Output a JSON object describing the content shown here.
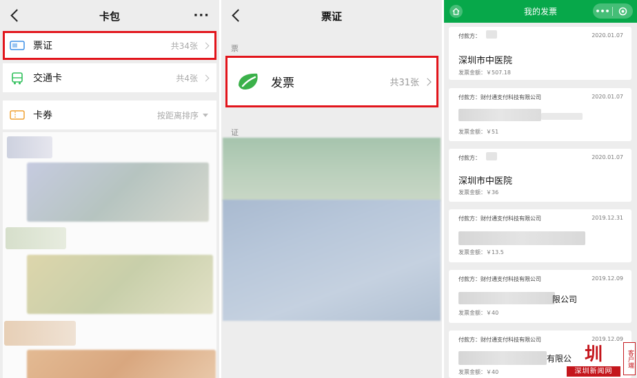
{
  "left": {
    "title": "卡包",
    "more": "···",
    "rows": [
      {
        "label": "票证",
        "count": "共34张"
      },
      {
        "label": "交通卡",
        "count": "共4张"
      },
      {
        "label": "卡券",
        "count": "按距离排序"
      }
    ]
  },
  "middle": {
    "title": "票证",
    "section_ticket": "票",
    "invoice_label": "发票",
    "invoice_count": "共31张",
    "section_cert": "证"
  },
  "right": {
    "title": "我的发票",
    "capsule_dots": "•••",
    "cards": [
      {
        "payer": "付款方：",
        "date": "2020.01.07",
        "big": "深圳市中医院",
        "amount": "发票金额：￥507.18"
      },
      {
        "payer": "付款方：财付通支付科技有限公司",
        "date": "2020.01.07",
        "big": "",
        "amount": "发票金额：￥51"
      },
      {
        "payer": "付款方：",
        "date": "2020.01.07",
        "big": "深圳市中医院",
        "amount": "发票金额：￥36"
      },
      {
        "payer": "付款方：财付通支付科技有限公司",
        "date": "2019.12.31",
        "big": "",
        "amount": "发票金额：￥13.5"
      },
      {
        "payer": "付款方：财付通支付科技有限公司",
        "date": "2019.12.09",
        "big": "限公司",
        "amount": "发票金额：￥40"
      },
      {
        "payer": "付款方：财付通支付科技有限公司",
        "date": "2019.12.09",
        "big": "有限公",
        "amount": "发票金额：￥40"
      }
    ]
  },
  "watermark": {
    "mark": "圳",
    "sub": "深圳新闻网",
    "vertical": "客户端"
  },
  "colors": {
    "highlight": "#e2141b",
    "green": "#07a84a",
    "brand_red": "#c4161c"
  }
}
